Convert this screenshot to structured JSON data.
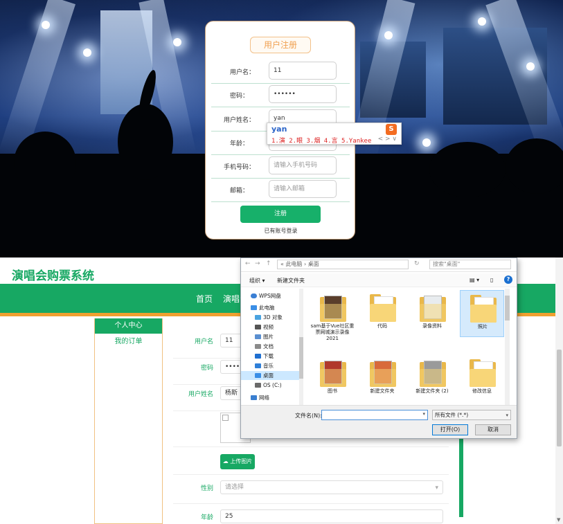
{
  "register": {
    "title": "用户注册",
    "fields": [
      {
        "label": "用户名：",
        "value": "11",
        "placeholder": ""
      },
      {
        "label": "密码：",
        "value": "••••••",
        "placeholder": ""
      },
      {
        "label": "用户姓名：",
        "value": "yan",
        "placeholder": ""
      },
      {
        "label": "年龄：",
        "value": "",
        "placeholder": ""
      },
      {
        "label": "手机号码：",
        "value": "",
        "placeholder": "请输入手机号码"
      },
      {
        "label": "邮箱：",
        "value": "",
        "placeholder": "请输入邮箱"
      }
    ],
    "submit_label": "注册",
    "login_link": "已有账号登录"
  },
  "ime": {
    "pinyin": "yan",
    "candidates": "1.演  2.眼  3.烟  4.言  5.Yankee",
    "logo": "S",
    "nav": "< >  ∨"
  },
  "site": {
    "brand": "演唱会购票系统",
    "nav": [
      "首页",
      "演唱会"
    ]
  },
  "sidebar": {
    "items": [
      {
        "label": "个人中心",
        "active": true
      },
      {
        "label": "我的订单",
        "active": false
      }
    ]
  },
  "profile_form": {
    "username_label": "用户名",
    "username_value": "11",
    "password_label": "密码",
    "password_value": "••••••",
    "realname_label": "用户姓名",
    "realname_value": "杨斯",
    "upload_label": "上传图片",
    "gender_label": "性别",
    "gender_placeholder": "请选择",
    "age_label": "年龄",
    "age_value": "25"
  },
  "file_dialog": {
    "path": "« 此电脑 › 桌面",
    "search_placeholder": "搜索\"桌面\"",
    "toolbar": {
      "organize": "组织 ▾",
      "new_folder": "新建文件夹",
      "help": "?"
    },
    "tree": [
      {
        "label": "WPS网盘",
        "icon": "cloud-icon",
        "color": "#3b7fd4"
      },
      {
        "label": "此电脑",
        "icon": "computer-icon",
        "color": "#3a8ee6"
      },
      {
        "label": "3D 对象",
        "icon": "cube-icon",
        "color": "#4aa3e0"
      },
      {
        "label": "视频",
        "icon": "video-icon",
        "color": "#555555"
      },
      {
        "label": "图片",
        "icon": "picture-icon",
        "color": "#5a8fd0"
      },
      {
        "label": "文档",
        "icon": "document-icon",
        "color": "#8a8a8a"
      },
      {
        "label": "下载",
        "icon": "download-icon",
        "color": "#1f6fd0"
      },
      {
        "label": "音乐",
        "icon": "music-icon",
        "color": "#2f7fd8"
      },
      {
        "label": "桌面",
        "icon": "desktop-icon",
        "color": "#3a8ee6"
      },
      {
        "label": "OS (C:)",
        "icon": "drive-icon",
        "color": "#6a6a6a"
      },
      {
        "label": "网络",
        "icon": "network-icon",
        "color": "#3a7fd0"
      }
    ],
    "selected_tree": 8,
    "files": [
      {
        "name": "sam基于Vue社区重票网城演示录像2021",
        "kind": "thumb",
        "color": "#5a3e2b"
      },
      {
        "name": "代码",
        "kind": "folder",
        "color": ""
      },
      {
        "name": "录像资料",
        "kind": "thumb",
        "color": "#e8ecef"
      },
      {
        "name": "照片",
        "kind": "folder",
        "color": ""
      },
      {
        "name": "图书",
        "kind": "thumb",
        "color": "#b0392b"
      },
      {
        "name": "新建文件夹",
        "kind": "thumb",
        "color": "#d86a3a"
      },
      {
        "name": "新建文件夹 (2)",
        "kind": "thumb",
        "color": "#9a9a9a"
      },
      {
        "name": "修改信息",
        "kind": "folder",
        "color": ""
      }
    ],
    "selected_file": 3,
    "filename_label": "文件名(N):",
    "filename_value": "",
    "filter": "所有文件 (*.*)",
    "open_label": "打开(O)",
    "cancel_label": "取消"
  }
}
